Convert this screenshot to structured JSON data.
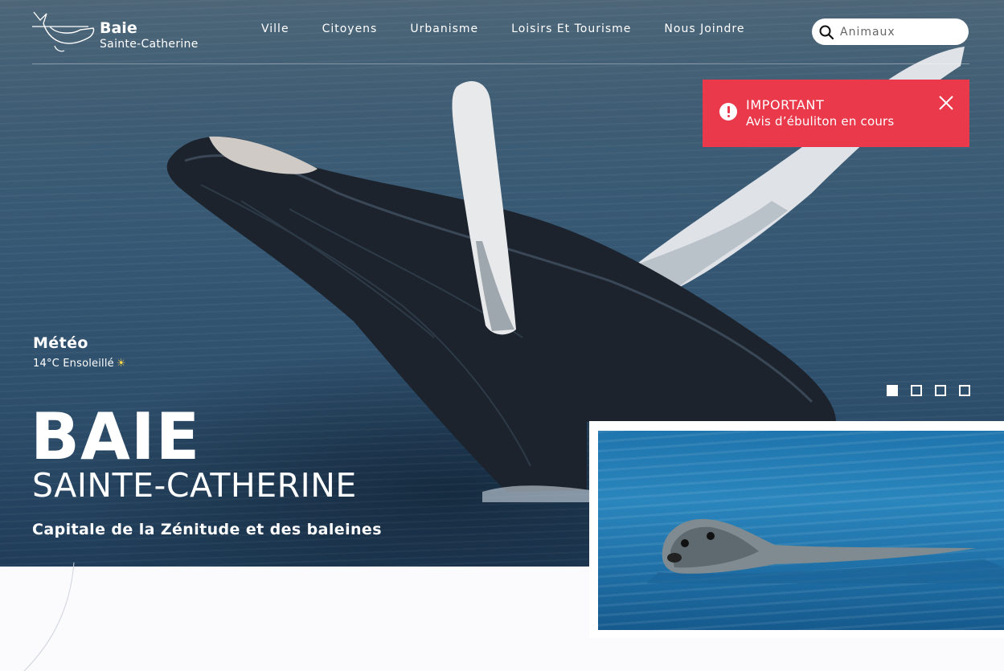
{
  "header": {
    "logo": {
      "title": "Baie",
      "subtitle": "Sainte-Catherine"
    },
    "nav": [
      "Ville",
      "Citoyens",
      "Urbanisme",
      "Loisirs Et Tourisme",
      "Nous Joindre"
    ],
    "search": {
      "value": "Animaux",
      "icon": "search-icon"
    }
  },
  "alert": {
    "title": "IMPORTANT",
    "text": "Avis d’ébuliton en cours",
    "color": "#e9394a",
    "icon": "exclamation-icon",
    "close_icon": "close-icon"
  },
  "weather": {
    "title": "Météo",
    "value": "14°C Ensoleillé",
    "icon": "sun-icon"
  },
  "hero": {
    "title": "BAIE",
    "subtitle": "SAINTE-CATHERINE",
    "tagline": "Capitale de la Zénitude et des baleines",
    "slides": {
      "count": 4,
      "active": 1
    }
  }
}
